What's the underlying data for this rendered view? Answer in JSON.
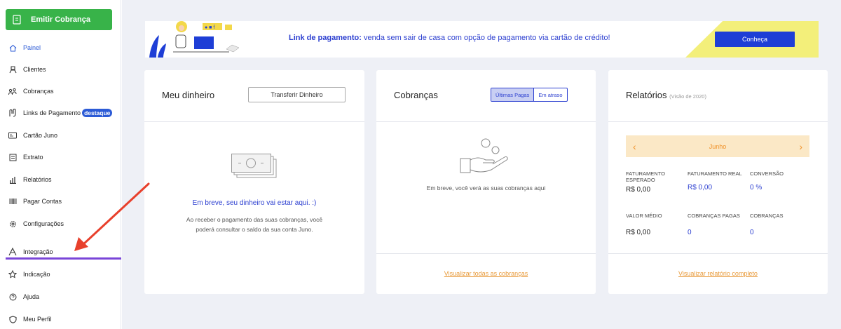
{
  "sidebar": {
    "emit_button": "Emitir Cobrança",
    "items": [
      {
        "label": "Painel",
        "icon": "home-icon"
      },
      {
        "label": "Clientes",
        "icon": "user-icon"
      },
      {
        "label": "Cobranças",
        "icon": "people-money-icon"
      },
      {
        "label": "Links de Pagamento",
        "icon": "link-icon",
        "badge": "destaque"
      },
      {
        "label": "Cartão Juno",
        "icon": "card-icon"
      },
      {
        "label": "Extrato",
        "icon": "receipt-icon"
      },
      {
        "label": "Relatórios",
        "icon": "bar-chart-icon"
      },
      {
        "label": "Pagar Contas",
        "icon": "barcode-icon"
      },
      {
        "label": "Configurações",
        "icon": "gear-icon"
      },
      {
        "label": "Integração",
        "icon": "integration-icon"
      },
      {
        "label": "Indicação",
        "icon": "star-icon"
      },
      {
        "label": "Ajuda",
        "icon": "help-icon"
      },
      {
        "label": "Meu Perfil",
        "icon": "shield-icon"
      }
    ]
  },
  "banner": {
    "bold": "Link de pagamento:",
    "text": " venda sem sair de casa com opção de pagamento via cartão de crédito!",
    "cta": "Conheça",
    "illustration_label": "● ■ f"
  },
  "money": {
    "title": "Meu dinheiro",
    "transfer": "Transferir Dinheiro",
    "headline": "Em breve, seu dinheiro vai estar aqui. :)",
    "desc_1": "Ao receber o pagamento das suas cobranças, você",
    "desc_2": "poderá consultar o saldo da sua conta Juno."
  },
  "charges": {
    "title": "Cobranças",
    "tab_paid": "Últimas Pagas",
    "tab_late": "Em atraso",
    "empty": "Em breve, você verá as suas cobranças aqui",
    "link": "Visualizar todas as cobranças"
  },
  "reports": {
    "title": "Relatórios",
    "subtitle": "(Visão de 2020)",
    "month": "Junho",
    "stats": {
      "fat_esperado_label_1": "FATURAMENTO",
      "fat_esperado_label_2": "ESPERADO",
      "fat_esperado": "R$ 0,00",
      "fat_real_label": "FATURAMENTO REAL",
      "fat_real": "R$ 0,00",
      "conversao_label": "CONVERSÃO",
      "conversao": "0 %",
      "valor_medio_label": "VALOR MÉDIO",
      "valor_medio": "R$ 0,00",
      "pagas_label": "COBRANÇAS PAGAS",
      "pagas": "0",
      "cobrancas_label": "COBRANÇAS",
      "cobrancas": "0"
    },
    "link": "Visualizar relatório completo"
  },
  "colors": {
    "accent": "#2c3fd0",
    "green": "#38b349",
    "orange": "#e89a3a",
    "purple": "#7a46d8",
    "arrow": "#e8402c"
  }
}
